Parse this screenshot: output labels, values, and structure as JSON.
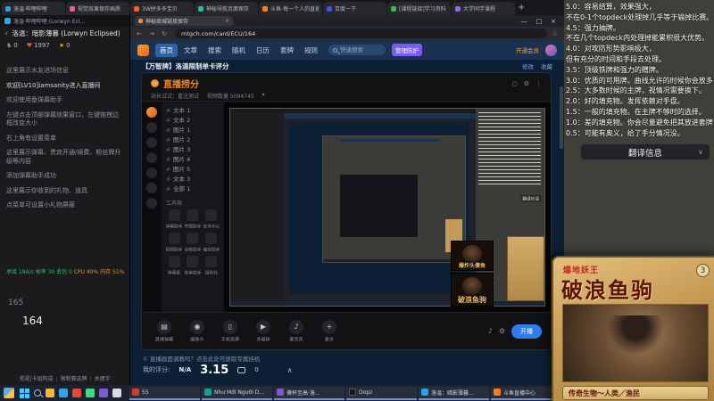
{
  "top_tabbar": {
    "new_tab": "+",
    "tabs": [
      {
        "label": "洛温·哔哩哔哩"
      },
      {
        "label": "视觉效果保存画质"
      },
      {
        "label": "3W拼多多宝贝"
      },
      {
        "label": "神秘导航页面保存"
      },
      {
        "label": "斗鱼-每一个人的直播平台"
      },
      {
        "label": "百度一下"
      },
      {
        "label": "[课程链接]学习资料"
      },
      {
        "label": "大学同学课程"
      }
    ]
  },
  "chat_panel": {
    "tab_label": "洛温·哔哩哔哩 (Lorwyn Ecl...",
    "title": "洛温：暗影薄暮 (Lorwyn Eclipsed)",
    "title_chevron": "∨",
    "stats": [
      {
        "icon": "♞",
        "value": "0"
      },
      {
        "icon": "♥",
        "value": "1997"
      },
      {
        "icon": "★",
        "value": "0"
      }
    ],
    "messages": [
      {
        "text": "这里展示水友进场信息"
      },
      {
        "text": "欢迎[LV10]iamsanity进入直播间"
      },
      {
        "text": "欢迎使用鱼弹幕助手"
      },
      {
        "text": "左键点击顶部弹幕效果窗口，左键拖拽边框改变大小"
      },
      {
        "text": "右上角有设置菜单"
      },
      {
        "text": "这里展示弹幕、贵宾开通/续费、粉丝牌升级等内容"
      },
      {
        "text": "添加弹幕助手成功"
      },
      {
        "text": "这里展示你收到的礼物、道具"
      },
      {
        "text": "点菜单可设置小礼物屏蔽"
      }
    ],
    "net_stats": "承接 18A/s 帧率 30 丢包 0",
    "perf_stats": "CPU 40% 内存 51%",
    "numbers": [
      {
        "value": "165"
      },
      {
        "value": "164"
      }
    ],
    "footer_links": [
      {
        "label": "常规|卡组构成"
      },
      {
        "label": "限制赛选牌"
      },
      {
        "label": "关键字"
      }
    ]
  },
  "browser": {
    "tab_label": "神秘商城链接保存",
    "tab_close": "×",
    "window_controls": {
      "min": "—",
      "max": "□",
      "close": "×"
    },
    "nav_buttons": "← → ↻",
    "url": "mtgch.com/card/ECU/164",
    "bookmark_star": "☆",
    "nav": {
      "items": [
        {
          "label": "首页"
        },
        {
          "label": "文章"
        },
        {
          "label": "搜索"
        },
        {
          "label": "随机"
        },
        {
          "label": "日历"
        },
        {
          "label": "套牌"
        },
        {
          "label": "规则"
        }
      ],
      "search_placeholder": "快速搜索",
      "badge": "管理防护",
      "member_link": "开通会员"
    },
    "page": {
      "title": "【万智牌】洛温限制单卡评分",
      "edit_link": "修改",
      "fav_link": "收藏",
      "notice": "① 直播画面调教吗？点击此处可获取专属挂机",
      "rating_label": "我的评分:",
      "rating_value": "N/A",
      "score": "3.15",
      "comments": "0",
      "collapse": "∧"
    }
  },
  "oopz": {
    "title": "直播捞分",
    "subtitle": "站长试试：重注测试",
    "stat": "视频数量 5094745",
    "stat_chevron": "▾",
    "channels": [
      {
        "label": "文本 1"
      },
      {
        "label": "文本 2"
      },
      {
        "label": "图片 1"
      },
      {
        "label": "图片 2"
      },
      {
        "label": "图片 3"
      },
      {
        "label": "图片 4"
      },
      {
        "label": "图片 5"
      },
      {
        "label": "文本 3"
      },
      {
        "label": "全部 1"
      }
    ],
    "toolbox_title": "工具箱",
    "tools": [
      {
        "label": "弹幕助手"
      },
      {
        "label": "房管助手"
      },
      {
        "label": "任务中心"
      },
      {
        "label": "视频助手"
      },
      {
        "label": "点歌助手"
      },
      {
        "label": "抽奖助手"
      },
      {
        "label": "弹幕篓"
      },
      {
        "label": "歌单助手"
      },
      {
        "label": "福利社"
      }
    ],
    "dock": [
      {
        "icon": "▤",
        "label": "直播弹幕"
      },
      {
        "icon": "◉",
        "label": "摄像头"
      },
      {
        "icon": "▯",
        "label": "手机投屏"
      },
      {
        "icon": "▶",
        "label": "多媒体"
      },
      {
        "icon": "♪",
        "label": "麦克风"
      },
      {
        "icon": "+",
        "label": "更多"
      }
    ],
    "live_button": "开播",
    "webcams": [
      {
        "label": "爆炸头傻鱼"
      },
      {
        "label": "破浪鱼驹"
      }
    ]
  },
  "rating_guide": {
    "lines": [
      {
        "text": "5.0：容易结算，效果强大，"
      },
      {
        "text": "不在0-1个topdeck处理掉几乎等于输掉比赛。"
      },
      {
        "text": "4.5：强力抽牌。"
      },
      {
        "text": "不在几个topdeck内处理掉能累积很大优势。"
      },
      {
        "text": "4.0：对攻防形势影响极大，"
      },
      {
        "text": "但有充分的时间和手段去处理。"
      },
      {
        "text": "3.5：顶级铁牌和强力的赠牌。"
      },
      {
        "text": "3.0：优质的可用牌。曲线允许的时候你会放多张。"
      },
      {
        "text": "2.5：大多数时候的主牌，视情况需要换下。"
      },
      {
        "text": "2.0：好的填充物。发挥依赖对手盘。"
      },
      {
        "text": "1.5：一般的填充物。在主牌不够时的选择。"
      },
      {
        "text": "1.0：差的填充物。你会尽量避免把其放进套牌。"
      },
      {
        "text": "0.5：可能有奥义，给了手分情况没。"
      }
    ]
  },
  "translate": {
    "label": "翻译信息",
    "chevron": "∨"
  },
  "card": {
    "seal": "爆地妖王",
    "title": "破浪鱼驹",
    "cost": "3",
    "type_line": "传奇生物～人类／渔民"
  },
  "taskbar": {
    "windows": [
      {
        "label": "55"
      },
      {
        "label": "Như Mới Người D..."
      },
      {
        "label": "傻杯至高·洛..."
      },
      {
        "label": "Oopz"
      },
      {
        "label": "洛温：暗影薄暮..."
      },
      {
        "label": "斗鱼直播中心"
      }
    ]
  }
}
